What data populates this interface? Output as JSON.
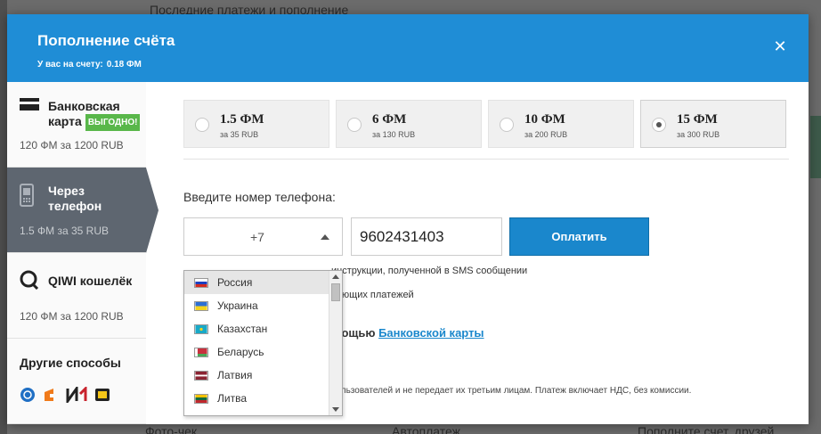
{
  "background": {
    "top_text": "Последние платежи и пополнение",
    "bottom_texts": [
      "Фото-чек",
      "Автоплатеж",
      "Пополните счет, друзей"
    ]
  },
  "modal": {
    "title": "Пополнение счёта",
    "balance_label": "У вас на счету:",
    "balance_value": "0.18 ФМ",
    "close_icon": "close-icon"
  },
  "sidebar": {
    "items": [
      {
        "title_line1": "Банковская",
        "title_line2": "карта",
        "badge": "ВЫГОДНО!",
        "sub": "120 ФМ за 1200 RUB",
        "icon": "bank-card-icon"
      },
      {
        "title_line1": "Через",
        "title_line2": "телефон",
        "sub": "1.5 ФМ за 35 RUB",
        "icon": "mobile-phone-icon"
      },
      {
        "title_line1": "QIWI кошелёк",
        "sub": "120 ФМ за 1200 RUB",
        "icon": "qiwi-icon"
      },
      {
        "title_line1": "Другие способы",
        "icons": [
          "webmoney-icon",
          "yandex-money-icon",
          "ii-icon",
          "yandex-wallet-icon"
        ]
      }
    ]
  },
  "amounts": [
    {
      "value": "1.5 ФМ",
      "price": "за 35 RUB",
      "selected": false
    },
    {
      "value": "6 ФМ",
      "price": "за 130 RUB",
      "selected": false
    },
    {
      "value": "10 ФМ",
      "price": "за 200 RUB",
      "selected": false
    },
    {
      "value": "15 ФМ",
      "price": "за 300 RUB",
      "selected": true
    }
  ],
  "phone": {
    "label": "Введите номер телефона:",
    "country_code": "+7",
    "number": "9602431403",
    "pay_button": "Оплатить"
  },
  "info": {
    "line1": "инструкции, полученной в SMS сообщении",
    "line2": "дующих платежей",
    "line3_prefix": "мощью",
    "line3_link": "Банковской карты",
    "footer": "пользователей и не передает их третьим лицам. Платеж включает НДС, без комиссии."
  },
  "country_dropdown": {
    "items": [
      {
        "label": "Россия",
        "flag": [
          "#ffffff",
          "#1c3fbf",
          "#d52b1e"
        ],
        "highlighted": true
      },
      {
        "label": "Украина",
        "flag": [
          "#2d6fd4",
          "#2d6fd4",
          "#f5d31c"
        ],
        "highlighted": false
      },
      {
        "label": "Казахстан",
        "flag": [
          "#18a9c7",
          "#18a9c7",
          "#18a9c7"
        ],
        "highlighted": false
      },
      {
        "label": "Беларусь",
        "flag": [
          "#c8313e",
          "#c8313e",
          "#4aa657"
        ],
        "highlighted": false
      },
      {
        "label": "Латвия",
        "flag": [
          "#8a2432",
          "#ffffff",
          "#8a2432"
        ],
        "highlighted": false
      },
      {
        "label": "Литва",
        "flag": [
          "#f4c100",
          "#126b3e",
          "#c1272d"
        ],
        "highlighted": false
      }
    ]
  }
}
